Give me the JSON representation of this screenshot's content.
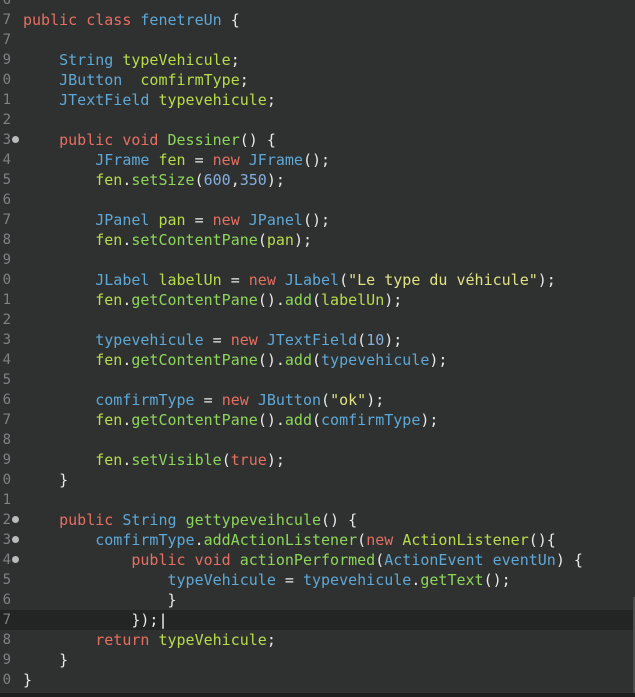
{
  "editor": {
    "line_numbers": [
      "6",
      "7",
      "8",
      "9",
      "0",
      "1",
      "2",
      "3",
      "4",
      "5",
      "6",
      "7",
      "8",
      "9",
      "0",
      "1",
      "2",
      "3",
      "4",
      "5",
      "6",
      "7",
      "8",
      "9",
      "0",
      "1",
      "2",
      "3",
      "4",
      "5",
      "6",
      "7",
      "8",
      "9",
      "0"
    ],
    "lines": [
      {
        "ln": "6",
        "fold": false,
        "tokens": []
      },
      {
        "ln": "7",
        "fold": false,
        "tokens": [
          {
            "t": "kw",
            "v": "public"
          },
          {
            "t": "tx",
            "v": " "
          },
          {
            "t": "kw",
            "v": "class"
          },
          {
            "t": "tx",
            "v": " "
          },
          {
            "t": "ty",
            "v": "fenetreUn"
          },
          {
            "t": "tx",
            "v": " {"
          }
        ]
      },
      {
        "ln": "7",
        "fold": false,
        "tokens": []
      },
      {
        "ln": "9",
        "fold": false,
        "tokens": [
          {
            "t": "tx",
            "v": "    "
          },
          {
            "t": "ty",
            "v": "String"
          },
          {
            "t": "tx",
            "v": " "
          },
          {
            "t": "id",
            "v": "typeVehicule"
          },
          {
            "t": "tx",
            "v": ";"
          }
        ]
      },
      {
        "ln": "0",
        "fold": false,
        "tokens": [
          {
            "t": "tx",
            "v": "    "
          },
          {
            "t": "ty",
            "v": "JButton"
          },
          {
            "t": "tx",
            "v": "  "
          },
          {
            "t": "id",
            "v": "comfirmType"
          },
          {
            "t": "tx",
            "v": ";"
          }
        ]
      },
      {
        "ln": "1",
        "fold": false,
        "tokens": [
          {
            "t": "tx",
            "v": "    "
          },
          {
            "t": "ty",
            "v": "JTextField"
          },
          {
            "t": "tx",
            "v": " "
          },
          {
            "t": "id",
            "v": "typevehicule"
          },
          {
            "t": "tx",
            "v": ";"
          }
        ]
      },
      {
        "ln": "2",
        "fold": false,
        "tokens": []
      },
      {
        "ln": "3",
        "fold": true,
        "tokens": [
          {
            "t": "tx",
            "v": "    "
          },
          {
            "t": "kw",
            "v": "public"
          },
          {
            "t": "tx",
            "v": " "
          },
          {
            "t": "kw",
            "v": "void"
          },
          {
            "t": "tx",
            "v": " "
          },
          {
            "t": "fn",
            "v": "Dessiner"
          },
          {
            "t": "tx",
            "v": "() {"
          }
        ]
      },
      {
        "ln": "4",
        "fold": false,
        "tokens": [
          {
            "t": "tx",
            "v": "        "
          },
          {
            "t": "ty",
            "v": "JFrame"
          },
          {
            "t": "tx",
            "v": " "
          },
          {
            "t": "id",
            "v": "fen"
          },
          {
            "t": "tx",
            "v": " = "
          },
          {
            "t": "kw",
            "v": "new"
          },
          {
            "t": "tx",
            "v": " "
          },
          {
            "t": "ty",
            "v": "JFrame"
          },
          {
            "t": "tx",
            "v": "();"
          }
        ]
      },
      {
        "ln": "5",
        "fold": false,
        "tokens": [
          {
            "t": "tx",
            "v": "        "
          },
          {
            "t": "id",
            "v": "fen"
          },
          {
            "t": "tx",
            "v": "."
          },
          {
            "t": "fn",
            "v": "setSize"
          },
          {
            "t": "tx",
            "v": "("
          },
          {
            "t": "nm",
            "v": "600"
          },
          {
            "t": "tx",
            "v": ","
          },
          {
            "t": "nm",
            "v": "350"
          },
          {
            "t": "tx",
            "v": ");"
          }
        ]
      },
      {
        "ln": "6",
        "fold": false,
        "tokens": []
      },
      {
        "ln": "7",
        "fold": false,
        "tokens": [
          {
            "t": "tx",
            "v": "        "
          },
          {
            "t": "ty",
            "v": "JPanel"
          },
          {
            "t": "tx",
            "v": " "
          },
          {
            "t": "id",
            "v": "pan"
          },
          {
            "t": "tx",
            "v": " = "
          },
          {
            "t": "kw",
            "v": "new"
          },
          {
            "t": "tx",
            "v": " "
          },
          {
            "t": "ty",
            "v": "JPanel"
          },
          {
            "t": "tx",
            "v": "();"
          }
        ]
      },
      {
        "ln": "8",
        "fold": false,
        "tokens": [
          {
            "t": "tx",
            "v": "        "
          },
          {
            "t": "id",
            "v": "fen"
          },
          {
            "t": "tx",
            "v": "."
          },
          {
            "t": "fn",
            "v": "setContentPane"
          },
          {
            "t": "tx",
            "v": "("
          },
          {
            "t": "id",
            "v": "pan"
          },
          {
            "t": "tx",
            "v": ");"
          }
        ]
      },
      {
        "ln": "9",
        "fold": false,
        "tokens": []
      },
      {
        "ln": "0",
        "fold": false,
        "tokens": [
          {
            "t": "tx",
            "v": "        "
          },
          {
            "t": "ty",
            "v": "JLabel"
          },
          {
            "t": "tx",
            "v": " "
          },
          {
            "t": "id",
            "v": "labelUn"
          },
          {
            "t": "tx",
            "v": " = "
          },
          {
            "t": "kw",
            "v": "new"
          },
          {
            "t": "tx",
            "v": " "
          },
          {
            "t": "ty",
            "v": "JLabel"
          },
          {
            "t": "tx",
            "v": "("
          },
          {
            "t": "st",
            "v": "\"Le type du véhicule\""
          },
          {
            "t": "tx",
            "v": ");"
          }
        ]
      },
      {
        "ln": "1",
        "fold": false,
        "tokens": [
          {
            "t": "tx",
            "v": "        "
          },
          {
            "t": "id",
            "v": "fen"
          },
          {
            "t": "tx",
            "v": "."
          },
          {
            "t": "fn",
            "v": "getContentPane"
          },
          {
            "t": "tx",
            "v": "()."
          },
          {
            "t": "fn",
            "v": "add"
          },
          {
            "t": "tx",
            "v": "("
          },
          {
            "t": "id",
            "v": "labelUn"
          },
          {
            "t": "tx",
            "v": ");"
          }
        ]
      },
      {
        "ln": "2",
        "fold": false,
        "tokens": []
      },
      {
        "ln": "3",
        "fold": false,
        "tokens": [
          {
            "t": "tx",
            "v": "        "
          },
          {
            "t": "ty",
            "v": "typevehicule"
          },
          {
            "t": "tx",
            "v": " = "
          },
          {
            "t": "kw",
            "v": "new"
          },
          {
            "t": "tx",
            "v": " "
          },
          {
            "t": "ty",
            "v": "JTextField"
          },
          {
            "t": "tx",
            "v": "("
          },
          {
            "t": "nm",
            "v": "10"
          },
          {
            "t": "tx",
            "v": ");"
          }
        ]
      },
      {
        "ln": "4",
        "fold": false,
        "tokens": [
          {
            "t": "tx",
            "v": "        "
          },
          {
            "t": "id",
            "v": "fen"
          },
          {
            "t": "tx",
            "v": "."
          },
          {
            "t": "fn",
            "v": "getContentPane"
          },
          {
            "t": "tx",
            "v": "()."
          },
          {
            "t": "fn",
            "v": "add"
          },
          {
            "t": "tx",
            "v": "("
          },
          {
            "t": "ty",
            "v": "typevehicule"
          },
          {
            "t": "tx",
            "v": ");"
          }
        ]
      },
      {
        "ln": "5",
        "fold": false,
        "tokens": []
      },
      {
        "ln": "6",
        "fold": false,
        "tokens": [
          {
            "t": "tx",
            "v": "        "
          },
          {
            "t": "ty",
            "v": "comfirmType"
          },
          {
            "t": "tx",
            "v": " = "
          },
          {
            "t": "kw",
            "v": "new"
          },
          {
            "t": "tx",
            "v": " "
          },
          {
            "t": "ty",
            "v": "JButton"
          },
          {
            "t": "tx",
            "v": "("
          },
          {
            "t": "st",
            "v": "\"ok\""
          },
          {
            "t": "tx",
            "v": ");"
          }
        ]
      },
      {
        "ln": "7",
        "fold": false,
        "tokens": [
          {
            "t": "tx",
            "v": "        "
          },
          {
            "t": "id",
            "v": "fen"
          },
          {
            "t": "tx",
            "v": "."
          },
          {
            "t": "fn",
            "v": "getContentPane"
          },
          {
            "t": "tx",
            "v": "()."
          },
          {
            "t": "fn",
            "v": "add"
          },
          {
            "t": "tx",
            "v": "("
          },
          {
            "t": "ty",
            "v": "comfirmType"
          },
          {
            "t": "tx",
            "v": ");"
          }
        ]
      },
      {
        "ln": "8",
        "fold": false,
        "tokens": []
      },
      {
        "ln": "9",
        "fold": false,
        "tokens": [
          {
            "t": "tx",
            "v": "        "
          },
          {
            "t": "id",
            "v": "fen"
          },
          {
            "t": "tx",
            "v": "."
          },
          {
            "t": "fn",
            "v": "setVisible"
          },
          {
            "t": "tx",
            "v": "("
          },
          {
            "t": "kw",
            "v": "true"
          },
          {
            "t": "tx",
            "v": ");"
          }
        ]
      },
      {
        "ln": "0",
        "fold": false,
        "tokens": [
          {
            "t": "tx",
            "v": "    }"
          }
        ]
      },
      {
        "ln": "1",
        "fold": false,
        "tokens": []
      },
      {
        "ln": "2",
        "fold": true,
        "tokens": [
          {
            "t": "tx",
            "v": "    "
          },
          {
            "t": "kw",
            "v": "public"
          },
          {
            "t": "tx",
            "v": " "
          },
          {
            "t": "ty",
            "v": "String"
          },
          {
            "t": "tx",
            "v": " "
          },
          {
            "t": "fn",
            "v": "gettypeveihcule"
          },
          {
            "t": "tx",
            "v": "() {"
          }
        ]
      },
      {
        "ln": "3",
        "fold": true,
        "tokens": [
          {
            "t": "tx",
            "v": "        "
          },
          {
            "t": "ty",
            "v": "comfirmType"
          },
          {
            "t": "tx",
            "v": "."
          },
          {
            "t": "fn",
            "v": "addActionListener"
          },
          {
            "t": "tx",
            "v": "("
          },
          {
            "t": "kw",
            "v": "new"
          },
          {
            "t": "tx",
            "v": " "
          },
          {
            "t": "id",
            "v": "ActionListener"
          },
          {
            "t": "tx",
            "v": "(){"
          }
        ]
      },
      {
        "ln": "4",
        "fold": true,
        "tokens": [
          {
            "t": "tx",
            "v": "            "
          },
          {
            "t": "kw",
            "v": "public"
          },
          {
            "t": "tx",
            "v": " "
          },
          {
            "t": "kw",
            "v": "void"
          },
          {
            "t": "tx",
            "v": " "
          },
          {
            "t": "fn",
            "v": "actionPerformed"
          },
          {
            "t": "tx",
            "v": "("
          },
          {
            "t": "ty",
            "v": "ActionEvent"
          },
          {
            "t": "tx",
            "v": " "
          },
          {
            "t": "ty",
            "v": "eventUn"
          },
          {
            "t": "tx",
            "v": ") {"
          }
        ]
      },
      {
        "ln": "5",
        "fold": false,
        "tokens": [
          {
            "t": "tx",
            "v": "                "
          },
          {
            "t": "ty",
            "v": "typeVehicule"
          },
          {
            "t": "tx",
            "v": " = "
          },
          {
            "t": "ty",
            "v": "typevehicule"
          },
          {
            "t": "tx",
            "v": "."
          },
          {
            "t": "fn",
            "v": "getText"
          },
          {
            "t": "tx",
            "v": "();"
          }
        ]
      },
      {
        "ln": "6",
        "fold": false,
        "tokens": [
          {
            "t": "tx",
            "v": "                }"
          }
        ]
      },
      {
        "ln": "7",
        "fold": false,
        "current": true,
        "tokens": [
          {
            "t": "tx",
            "v": "            });"
          },
          {
            "t": "caret",
            "v": "|"
          }
        ]
      },
      {
        "ln": "8",
        "fold": false,
        "tokens": [
          {
            "t": "tx",
            "v": "        "
          },
          {
            "t": "kw",
            "v": "return"
          },
          {
            "t": "tx",
            "v": " "
          },
          {
            "t": "id",
            "v": "typeVehicule"
          },
          {
            "t": "tx",
            "v": ";"
          }
        ]
      },
      {
        "ln": "9",
        "fold": false,
        "tokens": [
          {
            "t": "tx",
            "v": "    }"
          }
        ]
      },
      {
        "ln": "0",
        "fold": false,
        "tokens": [
          {
            "t": "tx",
            "v": "}"
          }
        ]
      }
    ]
  },
  "colors": {
    "background": "#2f3130",
    "keyword": "#e56f63",
    "type": "#5fa8d6",
    "method": "#8dd65b",
    "identifier": "#b8dc4c",
    "string": "#e0e383",
    "number": "#85aedf",
    "text": "#e9e9e9",
    "line_number": "#7e8284"
  }
}
